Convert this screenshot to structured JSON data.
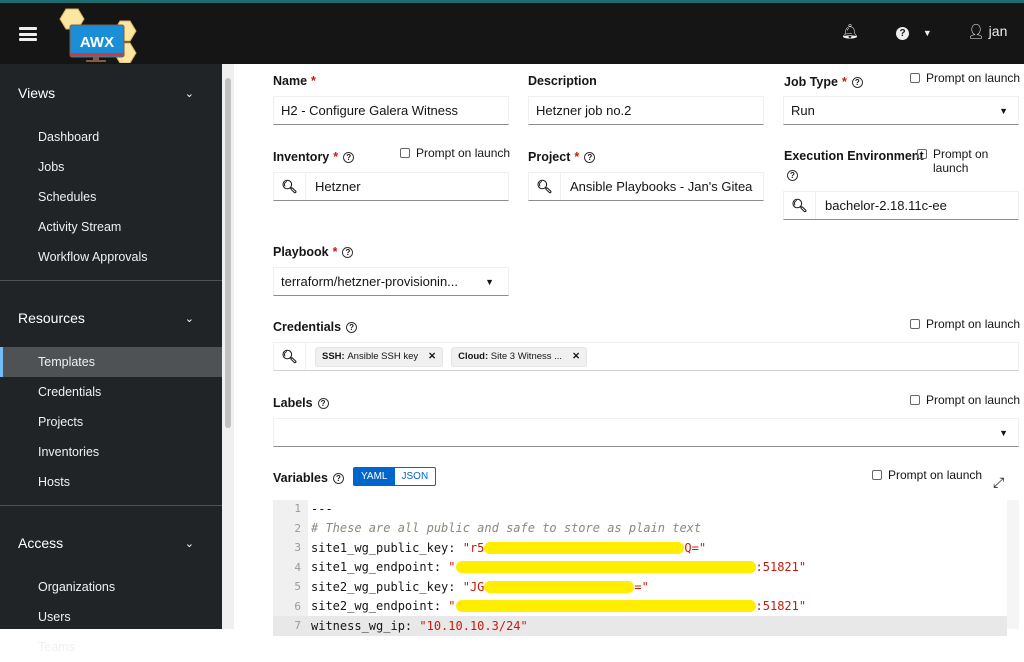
{
  "topbar": {
    "logo_text": "AWX",
    "user": "jan"
  },
  "sidebar": {
    "sections": [
      {
        "title": "Views",
        "items": [
          "Dashboard",
          "Jobs",
          "Schedules",
          "Activity Stream",
          "Workflow Approvals"
        ]
      },
      {
        "title": "Resources",
        "items": [
          "Templates",
          "Credentials",
          "Projects",
          "Inventories",
          "Hosts"
        ]
      },
      {
        "title": "Access",
        "items": [
          "Organizations",
          "Users",
          "Teams"
        ]
      }
    ],
    "active": "Templates"
  },
  "form": {
    "name": {
      "label": "Name",
      "value": "H2 - Configure Galera Witness"
    },
    "description": {
      "label": "Description",
      "value": "Hetzner job no.2"
    },
    "job_type": {
      "label": "Job Type",
      "value": "Run",
      "prompt": "Prompt on launch"
    },
    "inventory": {
      "label": "Inventory",
      "value": "Hetzner",
      "prompt": "Prompt on launch"
    },
    "project": {
      "label": "Project",
      "value": "Ansible Playbooks - Jan's Gitea"
    },
    "execution_environment": {
      "label": "Execution Environment",
      "value": "bachelor-2.18.11c-ee",
      "prompt_line1": "Prompt on",
      "prompt_line2": "launch"
    },
    "playbook": {
      "label": "Playbook",
      "value": "terraform/hetzner-provisionin..."
    },
    "credentials": {
      "label": "Credentials",
      "prompt": "Prompt on launch",
      "chips": [
        {
          "type": "SSH:",
          "name": "Ansible SSH key"
        },
        {
          "type": "Cloud:",
          "name": "Site 3 Witness ..."
        }
      ]
    },
    "labels": {
      "label": "Labels",
      "prompt": "Prompt on launch"
    },
    "variables": {
      "label": "Variables",
      "yaml": "YAML",
      "json": "JSON",
      "prompt": "Prompt on launch"
    }
  },
  "editor": {
    "lines": [
      {
        "n": "1",
        "key": "---"
      },
      {
        "n": "2",
        "comment": "# These are all public and safe to store as plain text"
      },
      {
        "n": "3",
        "key": "site1_wg_public_key: ",
        "pre": "\"r5",
        "post": "Q=\""
      },
      {
        "n": "4",
        "key": "site1_wg_endpoint: ",
        "pre": "\"",
        "post": ":51821\""
      },
      {
        "n": "5",
        "key": "site2_wg_public_key: ",
        "pre": "\"JG",
        "post": "=\""
      },
      {
        "n": "6",
        "key": "site2_wg_endpoint: ",
        "pre": "\"",
        "post": ":51821\""
      },
      {
        "n": "7",
        "key": "witness_wg_ip: ",
        "pre": "\"10.10.10.3/24\""
      }
    ]
  }
}
